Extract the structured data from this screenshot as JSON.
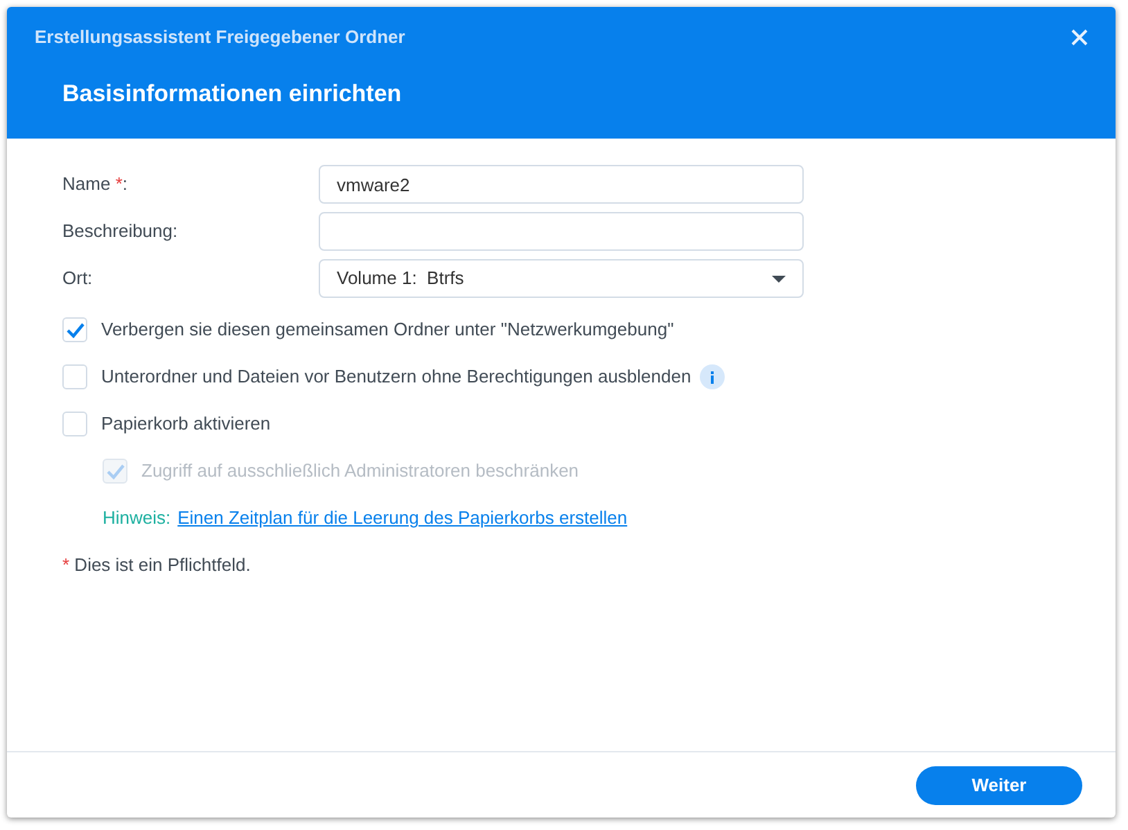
{
  "window": {
    "title": "Erstellungsassistent Freigegebener Ordner",
    "heading": "Basisinformationen einrichten"
  },
  "fields": [
    {
      "kind": "text",
      "label": "Name",
      "marker": "*",
      "suffix": ":",
      "value": "vmware2"
    },
    {
      "kind": "text",
      "label": "Beschreibung:"
    },
    {
      "kind": "select",
      "label": "Ort:",
      "value": "Volume 1:  Btrfs"
    }
  ],
  "options": [
    {
      "label": "Verbergen sie diesen gemeinsamen Ordner unter \"Netzwerkumgebung\"",
      "checked": true,
      "disabled": false
    },
    {
      "label": "Unterordner und Dateien vor Benutzern ohne Berechtigungen ausblenden",
      "checked": false,
      "disabled": false,
      "info": true
    },
    {
      "label": "Papierkorb aktivieren",
      "checked": false,
      "disabled": false,
      "children": [
        {
          "label": "Zugriff auf ausschließlich Administratoren beschränken",
          "checked": true,
          "disabled": true
        }
      ]
    }
  ],
  "hint": {
    "label": "Hinweis:",
    "link": "Einen Zeitplan für die Leerung des Papierkorbs erstellen"
  },
  "footnote": {
    "marker": "*",
    "text": "Dies ist ein Pflichtfeld."
  },
  "buttons": [
    "Weiter"
  ]
}
